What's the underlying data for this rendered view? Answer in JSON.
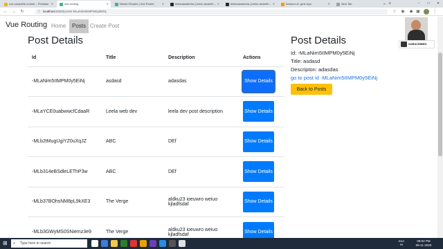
{
  "browser": {
    "tabs": [
      {
        "title": "vue-complete-course – Firebase",
        "color": "#f4b400",
        "active": false
      },
      {
        "title": "vue-routing",
        "color": "#41b883",
        "active": true
      },
      {
        "title": "Nested Routes | Vue Router",
        "color": "#41b883",
        "active": false
      },
      {
        "title": "leelanarasimha (Leela navanith…",
        "color": "#24292e",
        "active": false
      },
      {
        "title": "leelanarasimha (Leela navanith…",
        "color": "#24292e",
        "active": false
      },
      {
        "title": "Amazon.in: girls toys",
        "color": "#ff9900",
        "active": false
      },
      {
        "title": "New Tab",
        "color": "#9aa0a6",
        "active": false
      }
    ],
    "url_host": "localhost",
    "url_path": ":8080/posts/-MLaNim5IIMPM0y5EiNj",
    "icons": {
      "back": "arrow-left-icon",
      "forward": "arrow-right-icon",
      "reload": "reload-icon",
      "star": "star-icon",
      "menu": "kebab-menu-icon"
    }
  },
  "app": {
    "brand": "Vue Routing",
    "nav": [
      "Home",
      "Posts",
      "Create Post"
    ],
    "active_nav": "Posts"
  },
  "posts": {
    "heading": "Post Details",
    "columns": [
      "Id",
      "Title",
      "Description",
      "Actions"
    ],
    "button_label": "Show Details",
    "rows": [
      {
        "id": "-MLaNim5IIMPM0y5EiNj",
        "title": "asdasd",
        "description": "adasdas"
      },
      {
        "id": "-MLaYCE0uabwwcfCdaaR",
        "title": "Leela web dev",
        "description": "leela dev post description"
      },
      {
        "id": "-MLb2tMugUgiYZ0uXqJZ",
        "title": "ABC",
        "description": "DEf"
      },
      {
        "id": "-MLb314eBSdleLEThP3w",
        "title": "ABC",
        "description": "DEf"
      },
      {
        "id": "-MLb37BOhsNM8pL9kXE3",
        "title": "The Verge",
        "description": "aldku23 ioeuwro weiuo kjladfsdaf"
      },
      {
        "id": "-MLb3GWyMS0SNiemz3e9",
        "title": "The Verge",
        "description": "aldku23 ioeuwro weiuo kjladfsdaf"
      }
    ]
  },
  "detail": {
    "heading": "Post Details",
    "id_line": "Id: -MLaNim5IIMPM0y5EiNj",
    "title_line": "Title: asdasd",
    "description_line": "Descripton: adasdas",
    "link_text": "go to post id -MLaNim5IIMPM0y5EiNj",
    "back_button": "Back to Posts"
  },
  "overlay": {
    "subscribe": "SUBSCRIBED"
  },
  "taskbar": {
    "search_placeholder": "Type here to search",
    "language": "ENG",
    "region": "IN",
    "time": "09:02 PM",
    "date": "08-11-2020"
  }
}
